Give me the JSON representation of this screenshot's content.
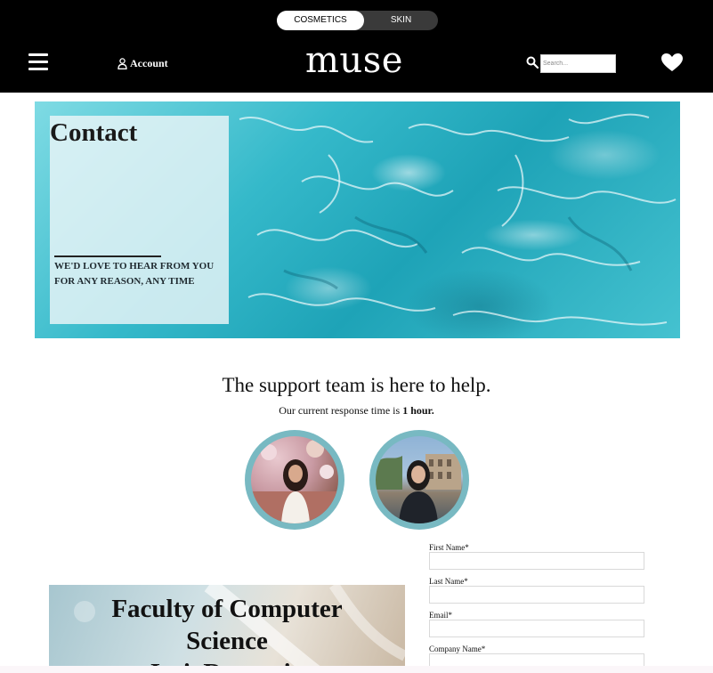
{
  "header": {
    "toggle": {
      "active": "COSMETICS",
      "inactive": "SKIN"
    },
    "account_label": "Account",
    "logo": "muse",
    "search_placeholder": "Search..."
  },
  "hero": {
    "title": "Contact",
    "tagline": "WE'D LOVE TO HEAR FROM YOU FOR ANY REASON, ANY TIME"
  },
  "support": {
    "title": "The support team is here to help.",
    "subtitle_prefix": "Our current response time is",
    "subtitle_bold": "1 hour."
  },
  "faculty_panel": {
    "line1": "Faculty of Computer",
    "line2": "Science",
    "line3": "Iasi, Romania"
  },
  "form": {
    "fields": [
      {
        "label": "First Name*"
      },
      {
        "label": "Last Name*"
      },
      {
        "label": "Email*"
      },
      {
        "label": "Company Name*"
      }
    ]
  },
  "colors": {
    "header_bg": "#000000",
    "avatar_ring": "#78b9c2",
    "water": "#1ea3b7"
  }
}
